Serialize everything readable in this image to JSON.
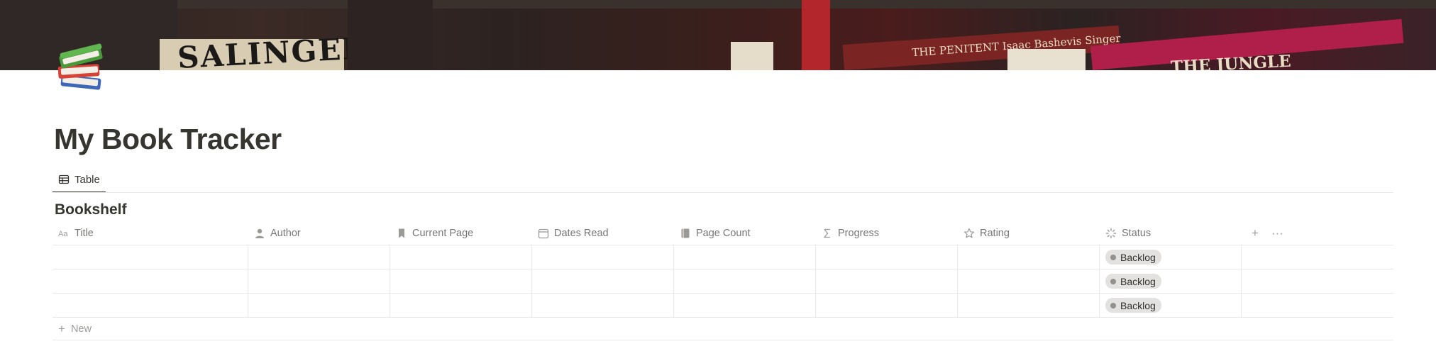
{
  "cover": {
    "spine_texts": [
      "SALINGER",
      "THE PENITENT  Isaac Bashevis Singer",
      "THE JUNGLE"
    ]
  },
  "page": {
    "icon": "books-icon",
    "title": "My Book Tracker"
  },
  "views": {
    "tabs": [
      {
        "label": "Table",
        "icon": "table-icon",
        "active": true
      }
    ]
  },
  "database": {
    "title": "Bookshelf",
    "columns": [
      {
        "label": "Title",
        "icon": "text-type-icon"
      },
      {
        "label": "Author",
        "icon": "person-icon"
      },
      {
        "label": "Current Page",
        "icon": "bookmark-icon"
      },
      {
        "label": "Dates Read",
        "icon": "calendar-icon"
      },
      {
        "label": "Page Count",
        "icon": "book-icon"
      },
      {
        "label": "Progress",
        "icon": "sigma-icon"
      },
      {
        "label": "Rating",
        "icon": "star-icon"
      },
      {
        "label": "Status",
        "icon": "status-icon"
      }
    ],
    "rows": [
      {
        "title": "",
        "author": "",
        "current_page": "",
        "dates_read": "",
        "page_count": "",
        "progress": "",
        "rating": "",
        "status": "Backlog"
      },
      {
        "title": "",
        "author": "",
        "current_page": "",
        "dates_read": "",
        "page_count": "",
        "progress": "",
        "rating": "",
        "status": "Backlog"
      },
      {
        "title": "",
        "author": "",
        "current_page": "",
        "dates_read": "",
        "page_count": "",
        "progress": "",
        "rating": "",
        "status": "Backlog"
      }
    ],
    "add_column_icon": "+",
    "more_icon": "···",
    "new_row_label": "New",
    "status_color": "#e3e2e0"
  }
}
